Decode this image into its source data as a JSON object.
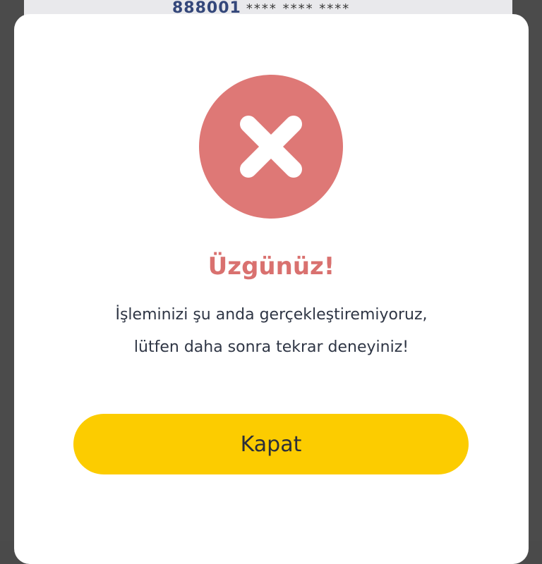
{
  "background_card": {
    "number_prefix": "888001",
    "number_mask": "**** **** ****"
  },
  "dialog": {
    "icon": "close-x-icon",
    "title": "Üzgünüz!",
    "message_line1": "İşleminizi şu anda gerçekleştiremiyoruz,",
    "message_line2": "lütfen daha sonra tekrar deneyiniz!",
    "close_label": "Kapat"
  },
  "colors": {
    "overlay": "#4b4b4b",
    "error_circle": "#de7876",
    "title": "#d9716f",
    "button": "#fccc00",
    "text": "#2f3645"
  }
}
